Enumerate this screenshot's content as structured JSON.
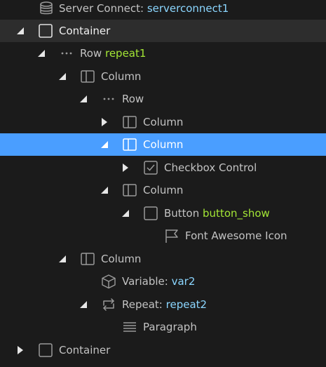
{
  "tree": {
    "server_connect": {
      "label": "Server Connect:",
      "name": "serverconnect1"
    },
    "container_1": {
      "label": "Container"
    },
    "row_repeat": {
      "label": "Row",
      "name": "repeat1"
    },
    "column_1": {
      "label": "Column"
    },
    "row_inner": {
      "label": "Row"
    },
    "column_2": {
      "label": "Column"
    },
    "column_selected": {
      "label": "Column"
    },
    "checkbox_control": {
      "label": "Checkbox Control"
    },
    "column_3": {
      "label": "Column"
    },
    "button_show": {
      "label": "Button",
      "name": "button_show"
    },
    "font_awesome_icon": {
      "label": "Font Awesome Icon"
    },
    "column_4": {
      "label": "Column"
    },
    "variable_var2": {
      "label": "Variable:",
      "name": "var2"
    },
    "repeat_repeat2": {
      "label": "Repeat:",
      "name": "repeat2"
    },
    "paragraph": {
      "label": "Paragraph"
    },
    "container_2": {
      "label": "Container"
    }
  },
  "colors": {
    "background": "#1b1b1b",
    "highlight_row": "#2d2d2d",
    "selected_row": "#4a9eff",
    "text": "#c3c3c3",
    "component_name_blue": "#8bd6ff",
    "component_name_green": "#a3e635"
  }
}
